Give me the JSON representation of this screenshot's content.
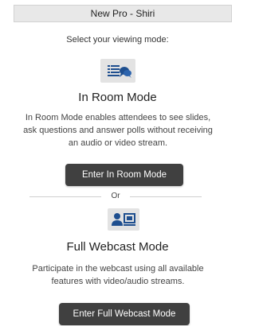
{
  "window": {
    "title": "New Pro - Shiri"
  },
  "prompt": "Select your viewing mode:",
  "in_room": {
    "icon": "presentation-chat-icon",
    "title": "In Room Mode",
    "description": "In Room Mode enables attendees to see slides, ask questions and answer polls without receiving an audio or video stream.",
    "button_label": "Enter In Room Mode"
  },
  "divider": {
    "label": "Or"
  },
  "webcast": {
    "icon": "presenter-screen-icon",
    "title": "Full Webcast Mode",
    "description": "Participate in the webcast using all available features with video/audio streams.",
    "button_label": "Enter Full Webcast Mode"
  },
  "colors": {
    "accent": "#1f4f8f",
    "button_bg": "#404040",
    "button_text": "#ffffff"
  }
}
